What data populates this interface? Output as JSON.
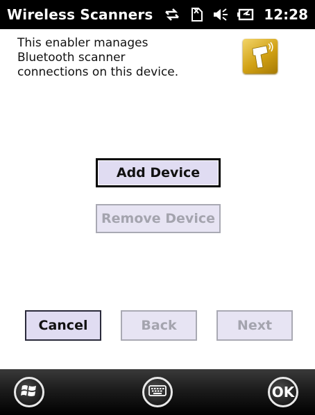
{
  "titlebar": {
    "app_title": "Wireless Scanners",
    "time": "12:28",
    "icons": [
      "connectivity-icon",
      "no-sim-icon",
      "volume-icon",
      "battery-icon"
    ]
  },
  "content": {
    "description": "This enabler manages\nBluetooth scanner\nconnections on this device.",
    "app_icon": "bluetooth-scanner-icon",
    "app_icon_color": "#d1a114"
  },
  "buttons": {
    "add_device": "Add Device",
    "remove_device": "Remove Device",
    "cancel": "Cancel",
    "back": "Back",
    "next": "Next"
  },
  "bottombar": {
    "start_icon": "windows-start-icon",
    "keyboard_icon": "keyboard-icon",
    "ok_label": "OK"
  },
  "colors": {
    "button_fill": "#e0dcf2",
    "disabled_text": "#a4a4ae",
    "titlebar": "#000000"
  }
}
